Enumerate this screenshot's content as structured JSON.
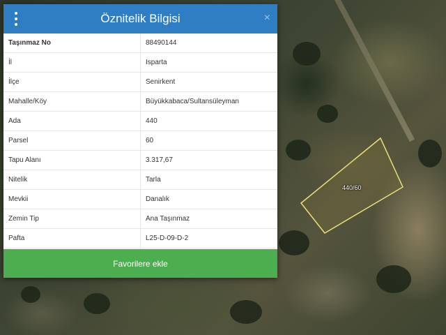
{
  "dialog": {
    "title": "Öznitelik Bilgisi",
    "close_glyph": "×",
    "rows": [
      {
        "key": "Taşınmaz No",
        "value": "88490144"
      },
      {
        "key": "İl",
        "value": "Isparta"
      },
      {
        "key": "İlçe",
        "value": "Senirkent"
      },
      {
        "key": "Mahalle/Köy",
        "value": "Büyükkabaca/Sultansüleyman"
      },
      {
        "key": "Ada",
        "value": "440"
      },
      {
        "key": "Parsel",
        "value": "60"
      },
      {
        "key": "Tapu Alanı",
        "value": "3.317,67"
      },
      {
        "key": "Nitelik",
        "value": "Tarla"
      },
      {
        "key": "Mevkii",
        "value": "Danalık"
      },
      {
        "key": "Zemin Tip",
        "value": "Ana Taşınmaz"
      },
      {
        "key": "Pafta",
        "value": "L25-D-09-D-2"
      }
    ],
    "favorite_button_label": "Favorilere ekle"
  },
  "map": {
    "parcel_label": "440/60",
    "parcel_outline_color": "#e8e07a"
  },
  "colors": {
    "header": "#2f7ec4",
    "button": "#4cae4f"
  },
  "icons": {
    "menu": "vertical-dots-icon",
    "close": "close-icon"
  }
}
